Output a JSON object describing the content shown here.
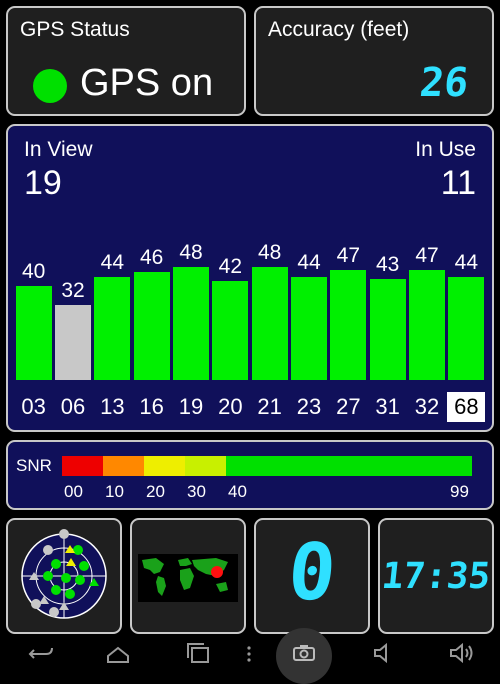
{
  "gps_status": {
    "title": "GPS Status",
    "state": "GPS on",
    "state_color": "#00e000"
  },
  "accuracy": {
    "title": "Accuracy (feet)",
    "value": "26"
  },
  "satellites": {
    "in_view_label": "In View",
    "in_view": "19",
    "in_use_label": "In Use",
    "in_use": "11",
    "bars": [
      {
        "prn": "03",
        "snr": 40,
        "label": "40",
        "in_use": true
      },
      {
        "prn": "06",
        "snr": 32,
        "label": "32",
        "in_use": false
      },
      {
        "prn": "13",
        "snr": 44,
        "label": "44",
        "in_use": true
      },
      {
        "prn": "16",
        "snr": 46,
        "label": "46",
        "in_use": true
      },
      {
        "prn": "19",
        "snr": 48,
        "label": "48",
        "in_use": true
      },
      {
        "prn": "20",
        "snr": 42,
        "label": "42",
        "in_use": true
      },
      {
        "prn": "21",
        "snr": 48,
        "label": "48",
        "in_use": true
      },
      {
        "prn": "23",
        "snr": 44,
        "label": "44",
        "in_use": true
      },
      {
        "prn": "27",
        "snr": 47,
        "label": "47",
        "in_use": true
      },
      {
        "prn": "31",
        "snr": 43,
        "label": "43",
        "in_use": true
      },
      {
        "prn": "32",
        "snr": 47,
        "label": "47",
        "in_use": true
      },
      {
        "prn": "68",
        "snr": 44,
        "label": "44",
        "in_use": true,
        "highlight": true
      }
    ],
    "colors": {
      "in_use": "#00f000",
      "not_used": "#c8c8c8"
    }
  },
  "snr_scale": {
    "title": "SNR",
    "bands": [
      {
        "from": 0,
        "to": 10,
        "color": "#ee0000"
      },
      {
        "from": 10,
        "to": 20,
        "color": "#ff8800"
      },
      {
        "from": 20,
        "to": 30,
        "color": "#eeee00"
      },
      {
        "from": 30,
        "to": 40,
        "color": "#c8f000"
      },
      {
        "from": 40,
        "to": 99,
        "color": "#00e000"
      }
    ],
    "ticks": [
      "00",
      "10",
      "20",
      "30",
      "40",
      "99"
    ]
  },
  "tiles": {
    "radar_icon": "sky-radar-icon",
    "map_icon": "world-map-icon",
    "counter": "0",
    "clock": "17:35"
  },
  "navbar": {
    "icons": [
      "back-icon",
      "home-icon",
      "recent-apps-icon",
      "menu-icon",
      "screenshot-icon",
      "volume-down-icon",
      "volume-up-icon"
    ]
  }
}
